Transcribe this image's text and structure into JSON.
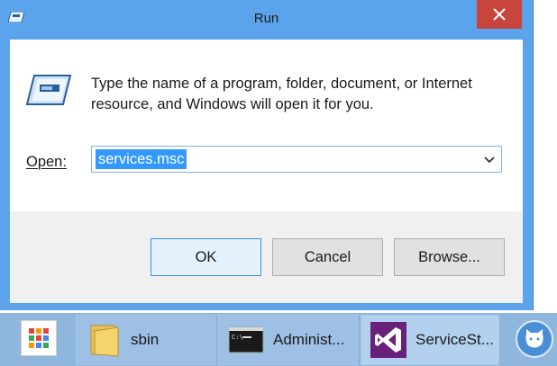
{
  "window": {
    "title": "Run",
    "description": "Type the name of a program, folder, document, or Internet resource, and Windows will open it for you.",
    "open_label": "Open:",
    "open_value": "services.msc",
    "buttons": {
      "ok": "OK",
      "cancel": "Cancel",
      "browse": "Browse..."
    },
    "icons": {
      "title": "run-icon",
      "close": "close-icon",
      "dropdown": "chevron-down-icon"
    },
    "colors": {
      "frame": "#5ba4ec",
      "close": "#c7453c",
      "selection": "#3399ff"
    }
  },
  "taskbar": {
    "items": [
      {
        "label": "",
        "icon": "apps-grid-icon"
      },
      {
        "label": "sbin",
        "icon": "folder-icon"
      },
      {
        "label": "Administ...",
        "icon": "command-prompt-icon"
      },
      {
        "label": "ServiceSt...",
        "icon": "visual-studio-icon"
      },
      {
        "label": "",
        "icon": "cat-avatar-icon"
      }
    ]
  }
}
